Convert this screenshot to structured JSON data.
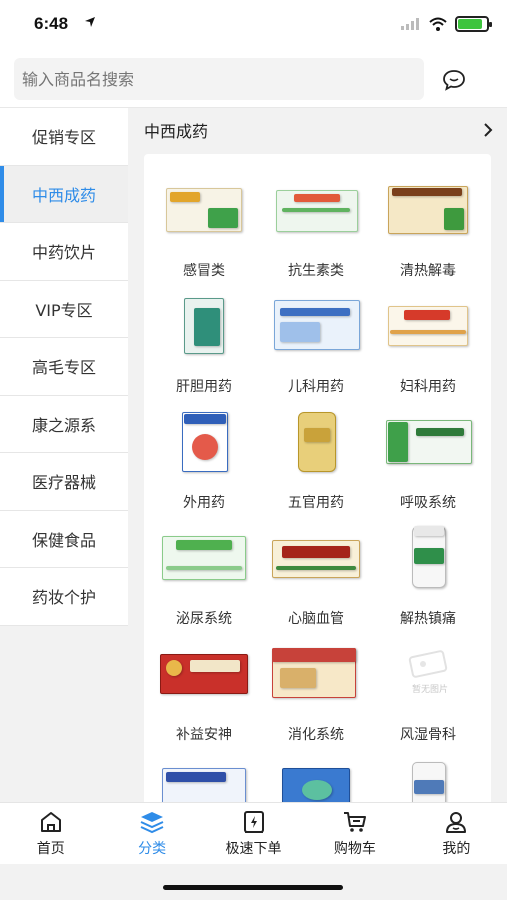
{
  "status": {
    "time": "6:48"
  },
  "search": {
    "placeholder": "输入商品名搜索"
  },
  "sidebar": {
    "items": [
      {
        "label": "促销专区"
      },
      {
        "label": "中西成药"
      },
      {
        "label": "中药饮片"
      },
      {
        "label": "VIP专区"
      },
      {
        "label": "高毛专区"
      },
      {
        "label": "康之源系"
      },
      {
        "label": "医疗器械"
      },
      {
        "label": "保健食品"
      },
      {
        "label": "药妆个护"
      }
    ],
    "active_index": 1
  },
  "main": {
    "title": "中西成药",
    "categories": [
      {
        "label": "感冒类"
      },
      {
        "label": "抗生素类"
      },
      {
        "label": "清热解毒"
      },
      {
        "label": "肝胆用药"
      },
      {
        "label": "儿科用药"
      },
      {
        "label": "妇科用药"
      },
      {
        "label": "外用药"
      },
      {
        "label": "五官用药"
      },
      {
        "label": "呼吸系统"
      },
      {
        "label": "泌尿系统"
      },
      {
        "label": "心脑血管"
      },
      {
        "label": "解热镇痛"
      },
      {
        "label": "补益安神"
      },
      {
        "label": "消化系统"
      },
      {
        "label": "风湿骨科"
      },
      {
        "label": ""
      },
      {
        "label": ""
      },
      {
        "label": ""
      }
    ],
    "placeholder_image_text": "暂无图片"
  },
  "tabbar": {
    "items": [
      {
        "label": "首页"
      },
      {
        "label": "分类"
      },
      {
        "label": "极速下单"
      },
      {
        "label": "购物车"
      },
      {
        "label": "我的"
      }
    ],
    "active_index": 1
  },
  "colors": {
    "accent": "#2f8ce8",
    "battery": "#3ec43e"
  }
}
